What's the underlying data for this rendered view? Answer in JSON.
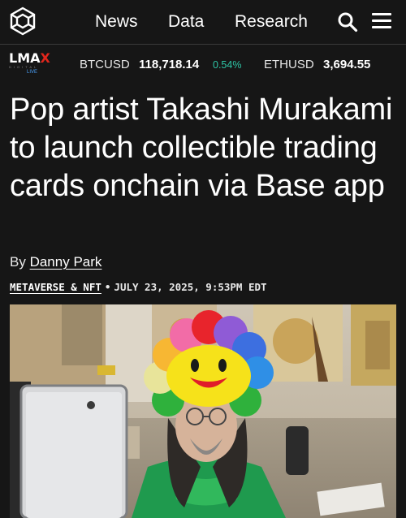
{
  "nav": {
    "logo_icon": "cube-logo-icon",
    "links": [
      "News",
      "Data",
      "Research"
    ],
    "search_icon": "search-icon",
    "menu_icon": "hamburger-menu-icon"
  },
  "ticker": {
    "brand": "LMAX",
    "brand_sub": "DIGITAL",
    "brand_live": "LIVE",
    "items": [
      {
        "symbol": "BTCUSD",
        "price": "118,718.14",
        "change": "0.54%"
      },
      {
        "symbol": "ETHUSD",
        "price": "3,694.55"
      }
    ],
    "change_color": "#2ec4a5"
  },
  "article": {
    "headline": "Pop artist Takashi Murakami to launch collectible trading cards onchain via Base app",
    "by_prefix": "By",
    "author": "Danny Park",
    "category": "METAVERSE & NFT",
    "separator": "•",
    "dateline": "JULY 23, 2025, 9:53PM EDT"
  },
  "colors": {
    "background": "#161616",
    "text": "#ffffff",
    "accent_red": "#e1261c"
  }
}
